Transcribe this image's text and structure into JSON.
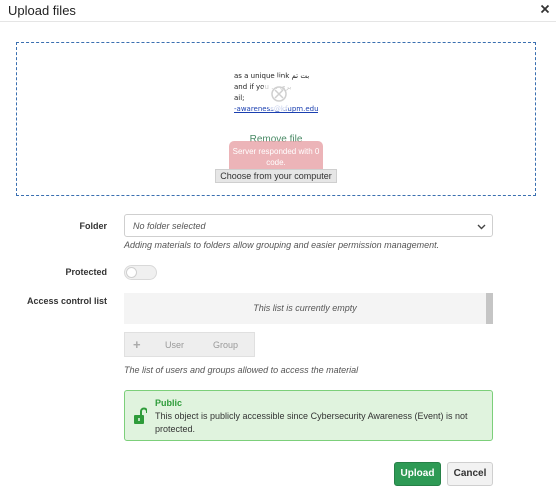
{
  "dialog": {
    "title": "Upload files",
    "close_icon": "close-icon"
  },
  "dropzone": {
    "thumbnail_lines": [
      "as a unique link ﺑﺖ ﺗﻢ",
      "and if you ... ﺑﺮﻱ",
      "ail;",
      "-awareness@kfupm.edu"
    ],
    "remove_file_label": "Remove file",
    "error_text": "Server responded with 0 code.",
    "choose_button_label": "Choose from your computer"
  },
  "folder": {
    "label": "Folder",
    "selected_value": "No folder selected",
    "help_text": "Adding materials to folders allow grouping and easier permission management."
  },
  "protected": {
    "label": "Protected",
    "enabled": false
  },
  "acl": {
    "label": "Access control list",
    "empty_message": "This list is currently empty",
    "add_icon": "+",
    "user_button_label": "User",
    "group_button_label": "Group",
    "help_text": "The list of users and groups allowed to access the material"
  },
  "public_notice": {
    "title": "Public",
    "text": "This object is publicly accessible since Cybersecurity Awareness (Event) is not protected.",
    "icon": "unlock-icon",
    "accent_color": "#2e9c3a"
  },
  "footer": {
    "upload_label": "Upload",
    "cancel_label": "Cancel",
    "upload_color": "#2e9a55"
  }
}
